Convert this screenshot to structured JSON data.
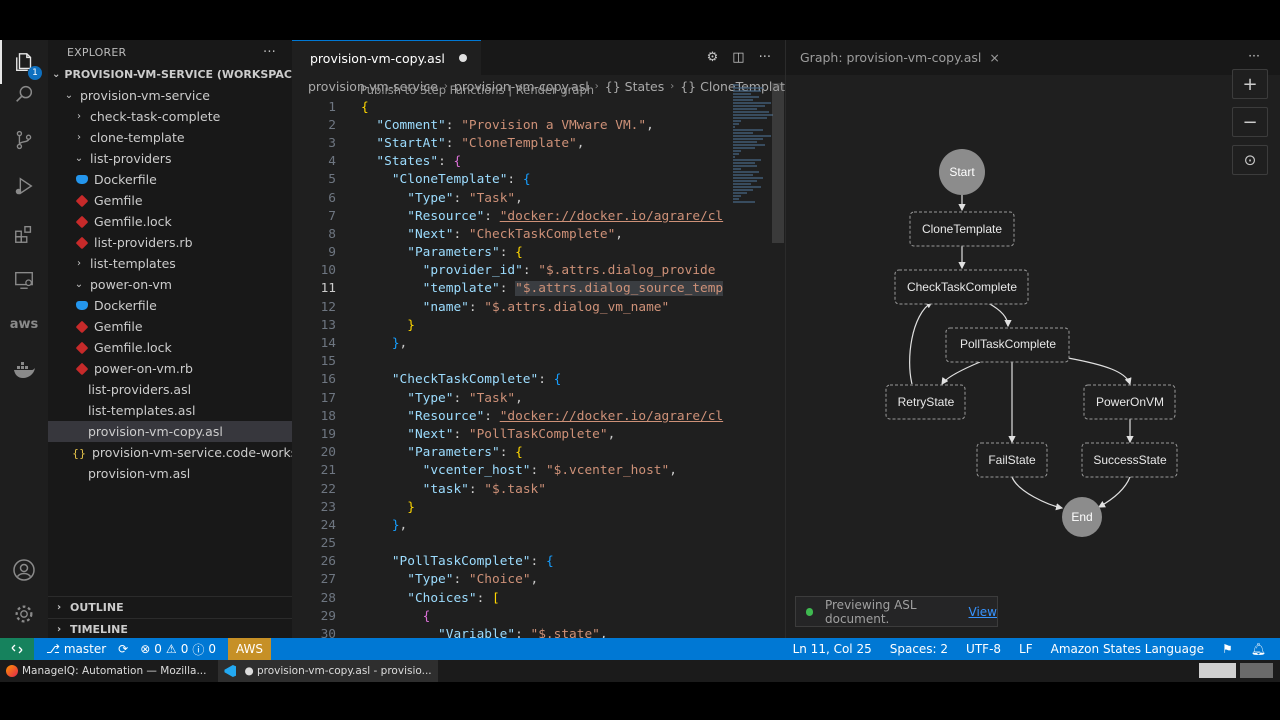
{
  "activity": {
    "badge": "1",
    "icons": [
      "files-icon",
      "search-icon",
      "source-control-icon",
      "run-debug-icon",
      "extensions-icon",
      "remote-explorer-icon",
      "aws-icon",
      "docker-icon",
      "account-icon",
      "settings-gear-icon"
    ],
    "aws_label": "aws"
  },
  "sidebar": {
    "title": "EXPLORER",
    "more": "···",
    "workspace": "PROVISION-VM-SERVICE (WORKSPACE)",
    "tree": [
      {
        "label": "provision-vm-service",
        "indent": 1,
        "chev": "⌄",
        "icon": ""
      },
      {
        "label": "check-task-complete",
        "indent": 2,
        "chev": "›",
        "icon": ""
      },
      {
        "label": "clone-template",
        "indent": 2,
        "chev": "›",
        "icon": ""
      },
      {
        "label": "list-providers",
        "indent": 2,
        "chev": "⌄",
        "icon": ""
      },
      {
        "label": "Dockerfile",
        "indent": 3,
        "chev": "",
        "icon": "docker"
      },
      {
        "label": "Gemfile",
        "indent": 3,
        "chev": "",
        "icon": "ruby"
      },
      {
        "label": "Gemfile.lock",
        "indent": 3,
        "chev": "",
        "icon": "ruby"
      },
      {
        "label": "list-providers.rb",
        "indent": 3,
        "chev": "",
        "icon": "ruby"
      },
      {
        "label": "list-templates",
        "indent": 2,
        "chev": "›",
        "icon": ""
      },
      {
        "label": "power-on-vm",
        "indent": 2,
        "chev": "⌄",
        "icon": ""
      },
      {
        "label": "Dockerfile",
        "indent": 3,
        "chev": "",
        "icon": "docker"
      },
      {
        "label": "Gemfile",
        "indent": 3,
        "chev": "",
        "icon": "ruby"
      },
      {
        "label": "Gemfile.lock",
        "indent": 3,
        "chev": "",
        "icon": "ruby"
      },
      {
        "label": "power-on-vm.rb",
        "indent": 3,
        "chev": "",
        "icon": "ruby"
      },
      {
        "label": "list-providers.asl",
        "indent": 2,
        "chev": "",
        "icon": ""
      },
      {
        "label": "list-templates.asl",
        "indent": 2,
        "chev": "",
        "icon": ""
      },
      {
        "label": "provision-vm-copy.asl",
        "indent": 2,
        "chev": "",
        "icon": "",
        "selected": true
      },
      {
        "label": "provision-vm-service.code-worksp...",
        "indent": 2,
        "chev": "",
        "icon": "json"
      },
      {
        "label": "provision-vm.asl",
        "indent": 2,
        "chev": "",
        "icon": ""
      }
    ],
    "outline": "OUTLINE",
    "timeline": "TIMELINE"
  },
  "editor": {
    "tab_label": "provision-vm-copy.asl",
    "breadcrumb": [
      "provision-vm-service",
      "provision-vm-copy.asl",
      "{} States",
      "{} CloneTemplate"
    ],
    "codelens": "Publish to Step Functions | Render graph",
    "current_line": 11,
    "lines": [
      {
        "n": "1",
        "h": "<span class='b1'>{</span>"
      },
      {
        "n": "2",
        "h": "  <span class='k'>\"Comment\"</span>: <span class='s'>\"Provision a VMware VM.\"</span>,"
      },
      {
        "n": "3",
        "h": "  <span class='k'>\"StartAt\"</span>: <span class='s'>\"CloneTemplate\"</span>,"
      },
      {
        "n": "4",
        "h": "  <span class='k'>\"States\"</span>: <span class='b2'>{</span>"
      },
      {
        "n": "5",
        "h": "    <span class='k'>\"CloneTemplate\"</span>: <span class='b3'>{</span>"
      },
      {
        "n": "6",
        "h": "      <span class='k'>\"Type\"</span>: <span class='s'>\"Task\"</span>,"
      },
      {
        "n": "7",
        "h": "      <span class='k'>\"Resource\"</span>: <span class='s u'>\"docker://docker.io/agrare/cl</span>"
      },
      {
        "n": "8",
        "h": "      <span class='k'>\"Next\"</span>: <span class='s'>\"CheckTaskComplete\"</span>,"
      },
      {
        "n": "9",
        "h": "      <span class='k'>\"Parameters\"</span>: <span class='b1'>{</span>"
      },
      {
        "n": "10",
        "h": "        <span class='k'>\"provider_id\"</span>: <span class='s'>\"$.attrs.dialog_provide</span>"
      },
      {
        "n": "11",
        "h": "        <span class='k'>\"template\"</span>: <span class='s hl'>\"$.attrs.dialog_source_temp</span>"
      },
      {
        "n": "12",
        "h": "        <span class='k'>\"name\"</span>: <span class='s'>\"$.attrs.dialog_vm_name\"</span>"
      },
      {
        "n": "13",
        "h": "      <span class='b1'>}</span>"
      },
      {
        "n": "14",
        "h": "    <span class='b3'>}</span>,"
      },
      {
        "n": "15",
        "h": ""
      },
      {
        "n": "16",
        "h": "    <span class='k'>\"CheckTaskComplete\"</span>: <span class='b3'>{</span>"
      },
      {
        "n": "17",
        "h": "      <span class='k'>\"Type\"</span>: <span class='s'>\"Task\"</span>,"
      },
      {
        "n": "18",
        "h": "      <span class='k'>\"Resource\"</span>: <span class='s u'>\"docker://docker.io/agrare/cl</span>"
      },
      {
        "n": "19",
        "h": "      <span class='k'>\"Next\"</span>: <span class='s'>\"PollTaskComplete\"</span>,"
      },
      {
        "n": "20",
        "h": "      <span class='k'>\"Parameters\"</span>: <span class='b1'>{</span>"
      },
      {
        "n": "21",
        "h": "        <span class='k'>\"vcenter_host\"</span>: <span class='s'>\"$.vcenter_host\"</span>,"
      },
      {
        "n": "22",
        "h": "        <span class='k'>\"task\"</span>: <span class='s'>\"$.task\"</span>"
      },
      {
        "n": "23",
        "h": "      <span class='b1'>}</span>"
      },
      {
        "n": "24",
        "h": "    <span class='b3'>}</span>,"
      },
      {
        "n": "25",
        "h": ""
      },
      {
        "n": "26",
        "h": "    <span class='k'>\"PollTaskComplete\"</span>: <span class='b3'>{</span>"
      },
      {
        "n": "27",
        "h": "      <span class='k'>\"Type\"</span>: <span class='s'>\"Choice\"</span>,"
      },
      {
        "n": "28",
        "h": "      <span class='k'>\"Choices\"</span>: <span class='b1'>[</span>"
      },
      {
        "n": "29",
        "h": "        <span class='b2'>{</span>"
      },
      {
        "n": "30",
        "h": "          <span class='k'>\"Variable\"</span>: <span class='s'>\"$.state\"</span>,"
      }
    ]
  },
  "graph": {
    "tab_label": "Graph: provision-vm-copy.asl",
    "close": "×",
    "more": "···",
    "zoom_in": "+",
    "zoom_out": "−",
    "center": "⊙",
    "nodes": {
      "start": "Start",
      "clone": "CloneTemplate",
      "check": "CheckTaskComplete",
      "poll": "PollTaskComplete",
      "retry": "RetryState",
      "poweron": "PowerOnVM",
      "fail": "FailState",
      "success": "SuccessState",
      "end": "End"
    },
    "toast_text": "Previewing ASL document.",
    "toast_link": "View"
  },
  "status": {
    "branch": "master",
    "errors": "0",
    "warnings": "0",
    "infos": "0",
    "aws": "AWS",
    "position": "Ln 11, Col 25",
    "spaces": "Spaces: 2",
    "encoding": "UTF-8",
    "eol": "LF",
    "language": "Amazon States Language"
  },
  "taskbar": {
    "firefox": "ManageIQ: Automation — Mozilla...",
    "vscode": "● provision-vm-copy.asl - provisio..."
  }
}
